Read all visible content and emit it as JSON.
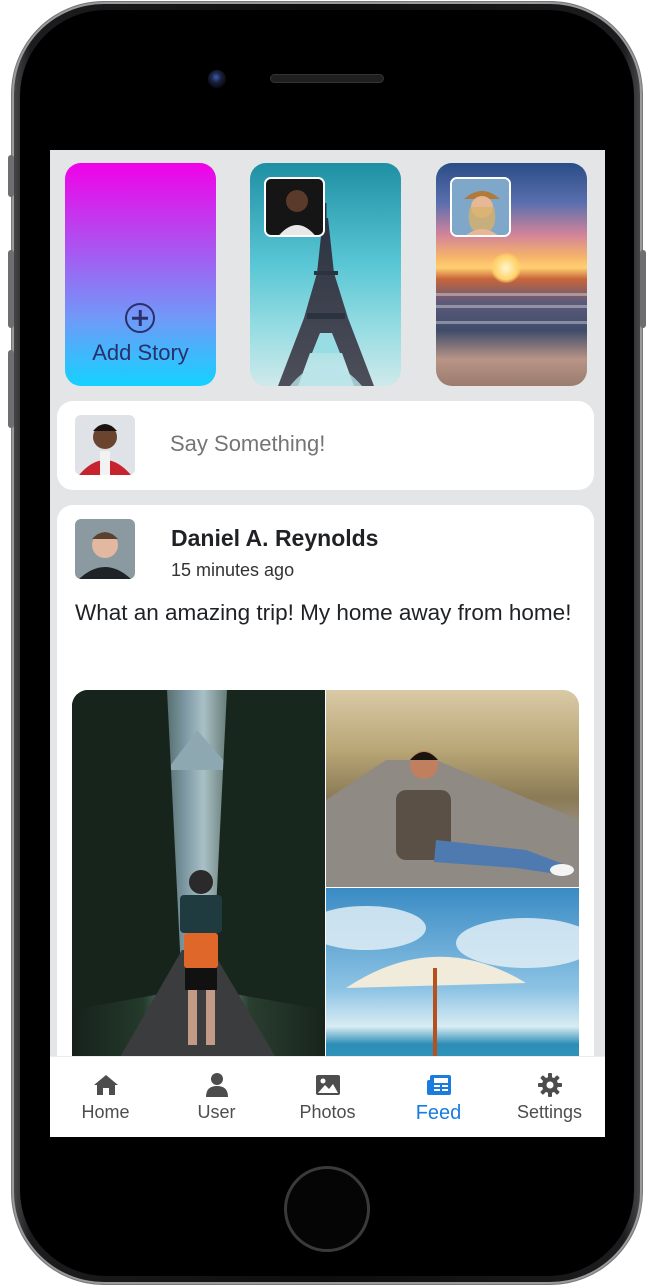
{
  "stories": {
    "add_label": "Add Story"
  },
  "composer": {
    "placeholder": "Say Something!"
  },
  "post": {
    "author": "Daniel A. Reynolds",
    "time": "15 minutes ago",
    "text": "What an amazing trip! My home away from home!"
  },
  "tabbar": {
    "items": [
      {
        "label": "Home",
        "icon": "home-icon"
      },
      {
        "label": "User",
        "icon": "user-icon"
      },
      {
        "label": "Photos",
        "icon": "photos-icon"
      },
      {
        "label": "Feed",
        "icon": "feed-icon",
        "active": true
      },
      {
        "label": "Settings",
        "icon": "gear-icon"
      }
    ]
  },
  "colors": {
    "accent": "#1b7ce0",
    "background": "#e4e5e7"
  }
}
